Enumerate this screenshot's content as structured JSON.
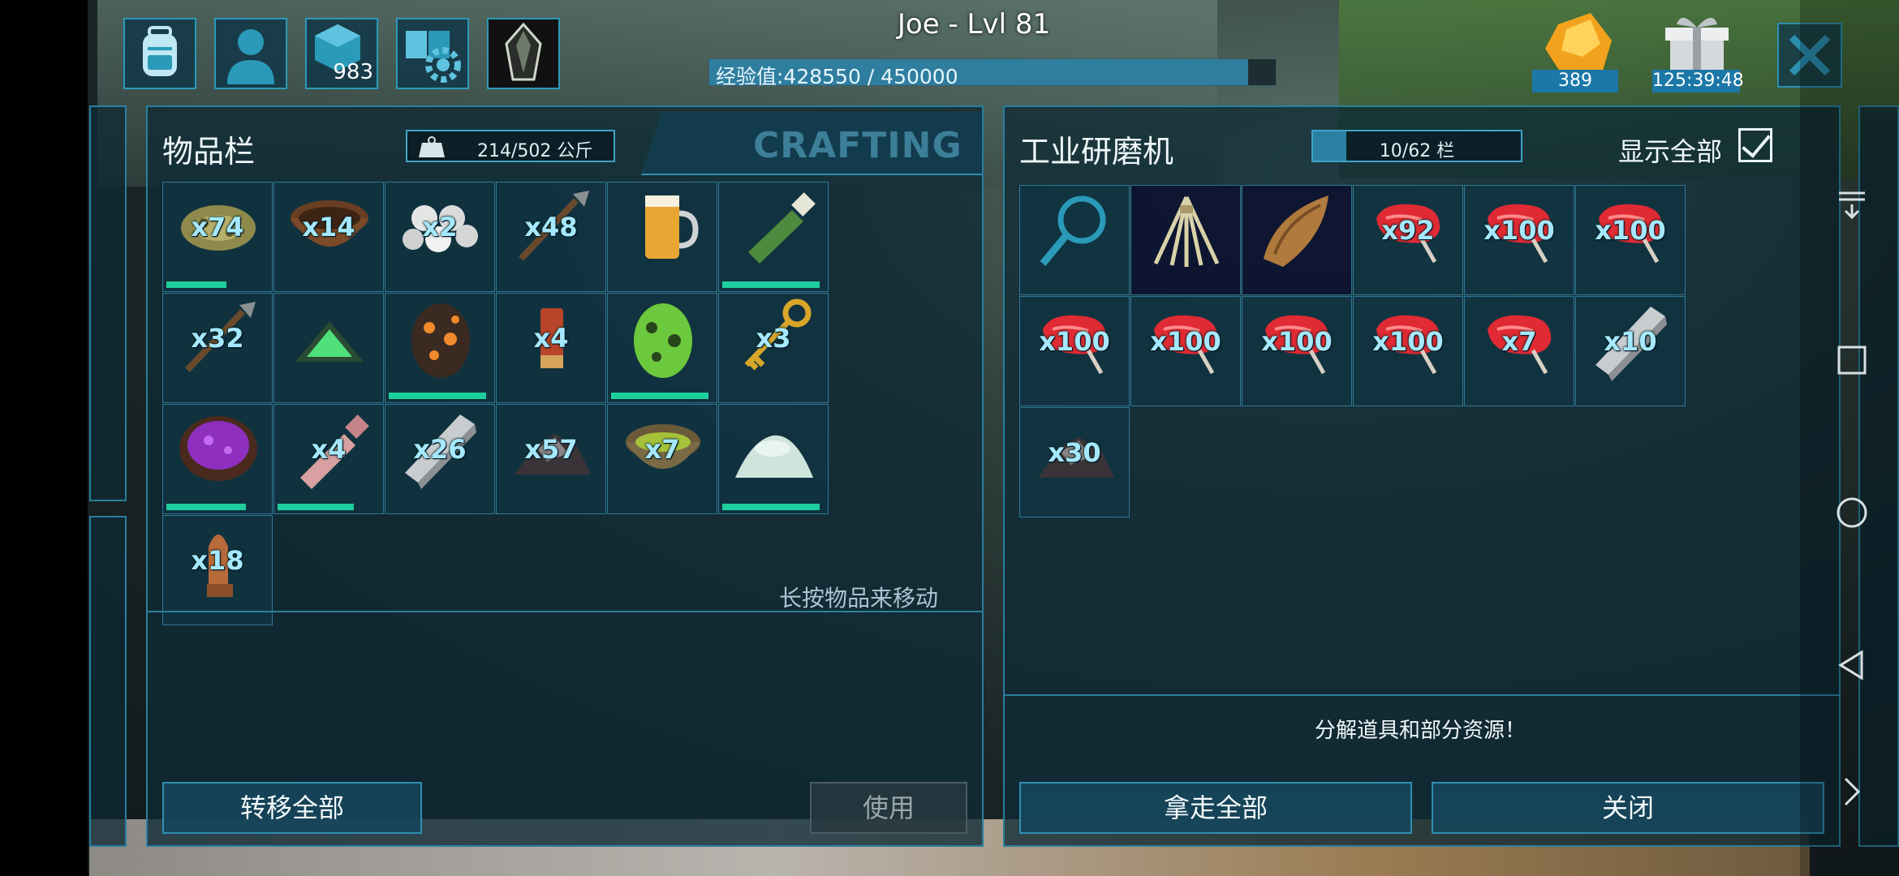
{
  "hud": {
    "player_name": "Joe - Lvl 81",
    "xp_text": "经验值:428550 / 450000",
    "xp_progress": 0.951,
    "engram_points": "983",
    "resource_count": "389",
    "timer": "125:39:48"
  },
  "inventory": {
    "title": "物品栏",
    "weight": "214/502 公斤",
    "crafting_tab": "CRAFTING",
    "hint": "长按物品来移动",
    "items": [
      {
        "icon": "hide-icon",
        "qty": "x74",
        "durability": 0.62
      },
      {
        "icon": "wooden-bowl-icon",
        "qty": "x14"
      },
      {
        "icon": "pearls-icon",
        "qty": "x2"
      },
      {
        "icon": "spear-icon",
        "qty": "x48"
      },
      {
        "icon": "beer-mug-icon",
        "qty": ""
      },
      {
        "icon": "green-bottle-icon",
        "qty": "",
        "durability": 1.0
      },
      {
        "icon": "spear-icon",
        "qty": "x32"
      },
      {
        "icon": "green-crystal-icon",
        "qty": ""
      },
      {
        "icon": "orange-spotted-egg-icon",
        "qty": "",
        "durability": 1.0
      },
      {
        "icon": "flare-shell-icon",
        "qty": "x4"
      },
      {
        "icon": "green-spotted-egg-icon",
        "qty": "",
        "durability": 1.0
      },
      {
        "icon": "golden-key-icon",
        "qty": "x3"
      },
      {
        "icon": "purple-bowl-icon",
        "qty": "",
        "durability": 0.82
      },
      {
        "icon": "pink-bottle-icon",
        "qty": "x4",
        "durability": 0.78
      },
      {
        "icon": "metal-ingot-icon",
        "qty": "x26"
      },
      {
        "icon": "obsidian-pile-icon",
        "qty": "x57"
      },
      {
        "icon": "fiber-bowl-icon",
        "qty": "x7"
      },
      {
        "icon": "white-powder-icon",
        "qty": "",
        "durability": 1.0
      },
      {
        "icon": "bullet-icon",
        "qty": "x18"
      }
    ],
    "transfer_all": "转移全部",
    "use": "使用"
  },
  "grinder": {
    "title": "工业研磨机",
    "slots": "10/62 栏",
    "slots_fill": 0.16,
    "show_all": "显示全部",
    "description": "分解道具和部分资源！",
    "items": [
      {
        "icon": "magnifier-icon",
        "qty": ""
      },
      {
        "icon": "thatch-icon",
        "qty": ""
      },
      {
        "icon": "leather-chunk-icon",
        "qty": ""
      },
      {
        "icon": "raw-meat-icon",
        "qty": "x92"
      },
      {
        "icon": "raw-meat-icon",
        "qty": "x100"
      },
      {
        "icon": "raw-meat-icon",
        "qty": "x100"
      },
      {
        "icon": "raw-meat-icon",
        "qty": "x100"
      },
      {
        "icon": "raw-meat-icon",
        "qty": "x100"
      },
      {
        "icon": "raw-meat-icon",
        "qty": "x100"
      },
      {
        "icon": "raw-meat-icon",
        "qty": "x100"
      },
      {
        "icon": "raw-meat-icon",
        "qty": "x7"
      },
      {
        "icon": "metal-ingot-icon",
        "qty": "x10"
      },
      {
        "icon": "obsidian-pile-icon",
        "qty": "x30"
      }
    ],
    "take_all": "拿走全部",
    "close": "关闭"
  },
  "colors": {
    "accent": "#2a9ab8",
    "panel": "#0e2a36",
    "quantity_text": "#a6e8ff",
    "durability": "#1ecf9e"
  }
}
